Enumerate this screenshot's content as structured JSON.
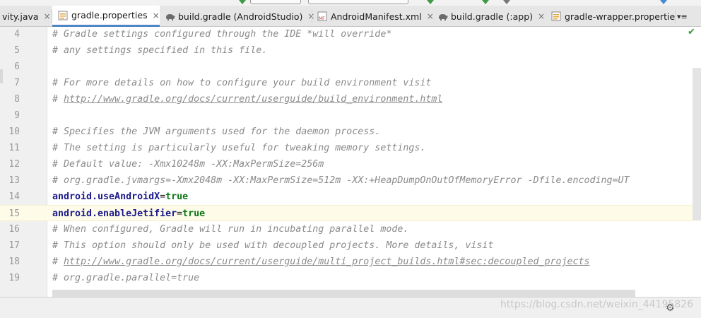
{
  "tabs": [
    {
      "label": "vity.java",
      "icon": "java-class-icon",
      "active": false
    },
    {
      "label": "gradle.properties",
      "icon": "properties-file-icon",
      "active": true
    },
    {
      "label": "build.gradle (AndroidStudio)",
      "icon": "gradle-elephant-icon",
      "active": false
    },
    {
      "label": "AndroidManifest.xml",
      "icon": "manifest-file-icon",
      "active": false
    },
    {
      "label": "build.gradle (:app)",
      "icon": "gradle-elephant-icon",
      "active": false
    },
    {
      "label": "gradle-wrapper.propertie:",
      "icon": "properties-file-icon",
      "active": false
    }
  ],
  "tab_close_glyph": "×",
  "tabs_menu_glyph": "▾≡",
  "lines": [
    {
      "num": "4",
      "text": "# Gradle settings configured through the IDE *will override*",
      "kind": "comment"
    },
    {
      "num": "5",
      "text": "# any settings specified in this file.",
      "kind": "comment"
    },
    {
      "num": "6",
      "text": "",
      "kind": "blank"
    },
    {
      "num": "7",
      "text": "# For more details on how to configure your build environment visit",
      "kind": "comment"
    },
    {
      "num": "8",
      "prefix": "# ",
      "text": "http://www.gradle.org/docs/current/userguide/build_environment.html",
      "kind": "url"
    },
    {
      "num": "9",
      "text": "",
      "kind": "blank"
    },
    {
      "num": "10",
      "text": "# Specifies the JVM arguments used for the daemon process.",
      "kind": "comment"
    },
    {
      "num": "11",
      "text": "# The setting is particularly useful for tweaking memory settings.",
      "kind": "comment"
    },
    {
      "num": "12",
      "text": "# Default value: -Xmx10248m -XX:MaxPermSize=256m",
      "kind": "comment"
    },
    {
      "num": "13",
      "text": "# org.gradle.jvmargs=-Xmx2048m -XX:MaxPermSize=512m -XX:+HeapDumpOnOutOfMemoryError -Dfile.encoding=UT",
      "kind": "comment"
    },
    {
      "num": "14",
      "key": "android.useAndroidX",
      "value": "true",
      "kind": "property"
    },
    {
      "num": "15",
      "key": "android.enableJetifier",
      "value": "true",
      "kind": "property",
      "current": true
    },
    {
      "num": "16",
      "text": "# When configured, Gradle will run in incubating parallel mode.",
      "kind": "comment"
    },
    {
      "num": "17",
      "text": "# This option should only be used with decoupled projects. More details, visit",
      "kind": "comment"
    },
    {
      "num": "18",
      "prefix": "# ",
      "text": "http://www.gradle.org/docs/current/userguide/multi_project_builds.html#sec:decoupled_projects",
      "kind": "url"
    },
    {
      "num": "19",
      "text": "# org.gradle.parallel=true",
      "kind": "comment"
    }
  ],
  "status_check_glyph": "✔",
  "gear_glyph": "⚙",
  "watermark": "https://blog.csdn.net/weixin_44195826",
  "colors": {
    "accent_tab_underline": "#4f86c6",
    "comment": "#8a8a8a",
    "property_key": "#1c1a8c",
    "property_value": "#0c7a18",
    "current_line": "#fefce8"
  }
}
